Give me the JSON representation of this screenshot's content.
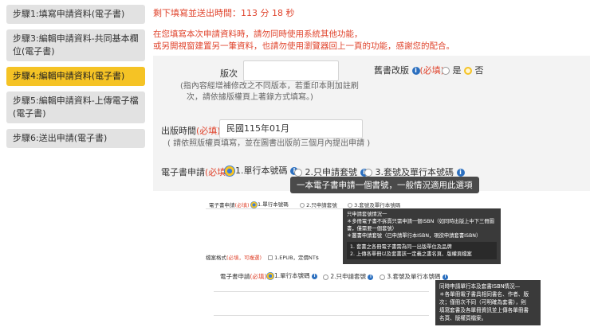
{
  "sidebar": {
    "steps": [
      {
        "label": "步驟1:填寫申請資料(電子書)"
      },
      {
        "label": "步驟3:編輯申請資料-共同基本欄位(電子書)"
      },
      {
        "label": "步驟4:編輯申請資料(電子書)"
      },
      {
        "label": "步驟5:編輯申請資料-上傳電子檔(電子書)"
      },
      {
        "label": "步驟6:送出申請(電子書)"
      }
    ]
  },
  "timer": "剩下填寫並送出時間：113 分 18 秒",
  "warning": {
    "line1": "在您填寫本次申請資料時，請勿同時使用系統其他功能，",
    "line2": "或另開視窗建置另一筆資料，也請勿使用瀏覽器回上一頁的功能，感謝您的配合。"
  },
  "form": {
    "edition_label": "版次",
    "edition_value": "",
    "edition_note1": "(指內容經增補修改之不同版本，若重印本則加註刷",
    "edition_note2": "次，請依據版權頁上著錄方式填寫。)",
    "revised_label": "舊書改版",
    "revised_required": "(必填)",
    "revised_yes": "是",
    "revised_no": "否",
    "pubdate_label": "出版時間",
    "pubdate_required": "(必填)",
    "pubdate_value": "民國115年01月",
    "pubdate_note": "( 請依照版權頁填寫，並在圖書出版前三個月內提出申請 )",
    "ebook_label": "電子書申請",
    "ebook_required": "(必填)",
    "ebook_opt1": "1.單行本號碼",
    "ebook_opt2": "2.只申請套號",
    "ebook_opt3": "3.套號及單行本號碼",
    "tooltip": "一本電子書申請一個書號，一般情況適用此選項"
  },
  "shot1": {
    "label": "電子書申請",
    "required": "(必填)",
    "opt1": "1.單行本號碼",
    "opt2": "2.只申請套號",
    "opt3": "3.套號及單行本號碼",
    "title": "只申請套號情況一",
    "l1": "＊多冊電子書不拆賣只需申請一個ISBN（如同時出版上中下三冊圖",
    "l2": "書，僅需要一個套號）",
    "l3": "＊叢書申請套號（已申請單行本ISBN，現欲申請套書ISBN）",
    "i1": "1. 套書之各冊電子書需為同一出版單位及品牌",
    "i2": "2. 上傳各單冊以及套書該一定義之書名頁、版權頁檔案",
    "format_label": "檔案格式",
    "format_req": "(必填，可複選)",
    "format_opt": "1.EPUB，定價NT$"
  },
  "shot2": {
    "label": "電子書申請",
    "required": "(必填)",
    "opt1": "1.單行本號碼",
    "opt2": "2.只申請套號",
    "opt3": "3.套號及單行本號碼",
    "title": "同時申請單行本及套書ISBN情況—",
    "l1": "＊各單冊電子書具相同書名、作者、版",
    "l2": "次；僅冊次不同（可明確為套書），則",
    "l3": "填寫套書及各單冊資訊並上傳各單冊書",
    "l4": "名頁、版權頁檔案。"
  }
}
